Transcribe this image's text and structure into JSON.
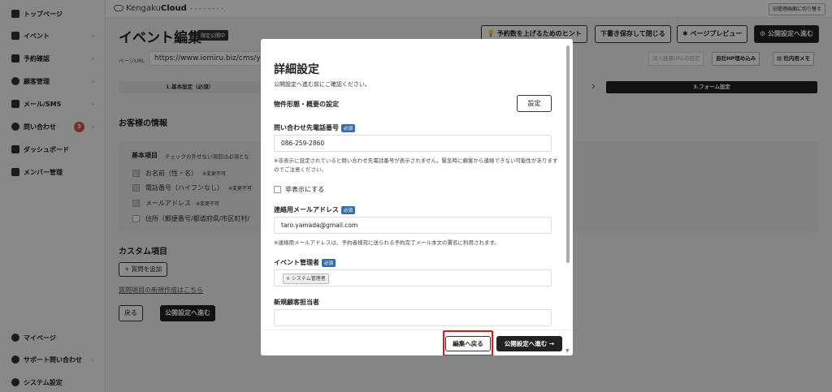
{
  "sidebar": {
    "items": [
      {
        "label": "トップページ",
        "icon": "home-icon",
        "chev": ""
      },
      {
        "label": "イベント",
        "icon": "document-icon",
        "chev": "›"
      },
      {
        "label": "予約確認",
        "icon": "calendar-icon",
        "chev": "›"
      },
      {
        "label": "顧客管理",
        "icon": "users-icon",
        "chev": "›"
      },
      {
        "label": "メール/SMS",
        "icon": "mail-icon",
        "chev": "›"
      },
      {
        "label": "問い合わせ",
        "icon": "chat-icon",
        "chev": "›",
        "badge": "3"
      },
      {
        "label": "ダッシュボード",
        "icon": "chart-icon",
        "chev": ""
      },
      {
        "label": "メンバー管理",
        "icon": "grid-icon",
        "chev": ""
      }
    ],
    "bottom": [
      {
        "label": "マイページ",
        "icon": "person-icon"
      },
      {
        "label": "サポート問い合わせ",
        "icon": "help-icon",
        "chev": "›"
      },
      {
        "label": "システム設定",
        "icon": "gear-icon"
      }
    ]
  },
  "topbar": {
    "logo_prefix": "Kengaku",
    "logo_bold": "Cloud",
    "logo_dots": "• • • • • • • •",
    "right_button": "旧管理画面に切り替え"
  },
  "header": {
    "title": "イベント編集",
    "tag": "限定公開中",
    "buttons": {
      "hint": "予約数を上げるためのヒント",
      "save_close": "下書き保存して閉じる",
      "preview": "ページプレビュー",
      "publish": "公開設定へ進む"
    }
  },
  "url": {
    "label": "ページURL",
    "value": "https://www.iemiru.biz/cms/yo",
    "btn_embed_disabled": "流入経路URLの設定",
    "btn_embed": "自社HP埋め込み",
    "btn_memo": "社内用メモ"
  },
  "steps": {
    "step1": "1.基本設定（必須）",
    "step3": "3.フォーム設定"
  },
  "customer_info": {
    "title": "お客様の情報",
    "card_title": "基本項目",
    "card_sub": "チェックの外せない項目は必須とな",
    "rows": [
      {
        "label": "お名前（性・名）",
        "note": "※変更不可",
        "checked": true
      },
      {
        "label": "電話番号（ハイフンなし）",
        "note": "※変更不可",
        "checked": true
      },
      {
        "label": "メールアドレス",
        "note": "※変更不可",
        "checked": true
      },
      {
        "label": "住所（郵便番号/都道府県/市区町村/",
        "note": "",
        "checked": false
      }
    ]
  },
  "custom": {
    "title": "カスタム項目",
    "add_button": "+ 質問を追加",
    "link": "質問項目の新規作成はこちら",
    "back_button": "戻る",
    "publish_button": "公開設定へ進む"
  },
  "modal": {
    "title": "詳細設定",
    "subtitle": "公開設定へ進む前にご確認ください。",
    "property_label": "物件形態・概要の設定",
    "property_button": "設定",
    "phone_label": "問い合わせ先電話番号",
    "required": "必須",
    "phone_value": "086-259-2860",
    "phone_help": "※非表示に設定されていると問い合わせ先電話番号が表示されません。緊急時に顧客から連絡できない可能性がありますのでご注意ください。",
    "hide_label": "非表示にする",
    "email_label": "連絡用メールアドレス",
    "email_value": "taro.yamada@gmail.com",
    "email_help": "※連絡用メールアドレスは、予約者様宛に送られる予約完了メール本文の署名に利用されます。",
    "manager_label": "イベント管理者",
    "manager_tag": "× システム管理者",
    "new_staff_label": "新規顧客担当者",
    "footer_back": "編集へ戻る",
    "footer_publish": "公開設定へ進む →"
  },
  "colors": {
    "highlight": "#e0161b",
    "required_badge": "#3a6ea5",
    "dark_button": "#222222"
  }
}
